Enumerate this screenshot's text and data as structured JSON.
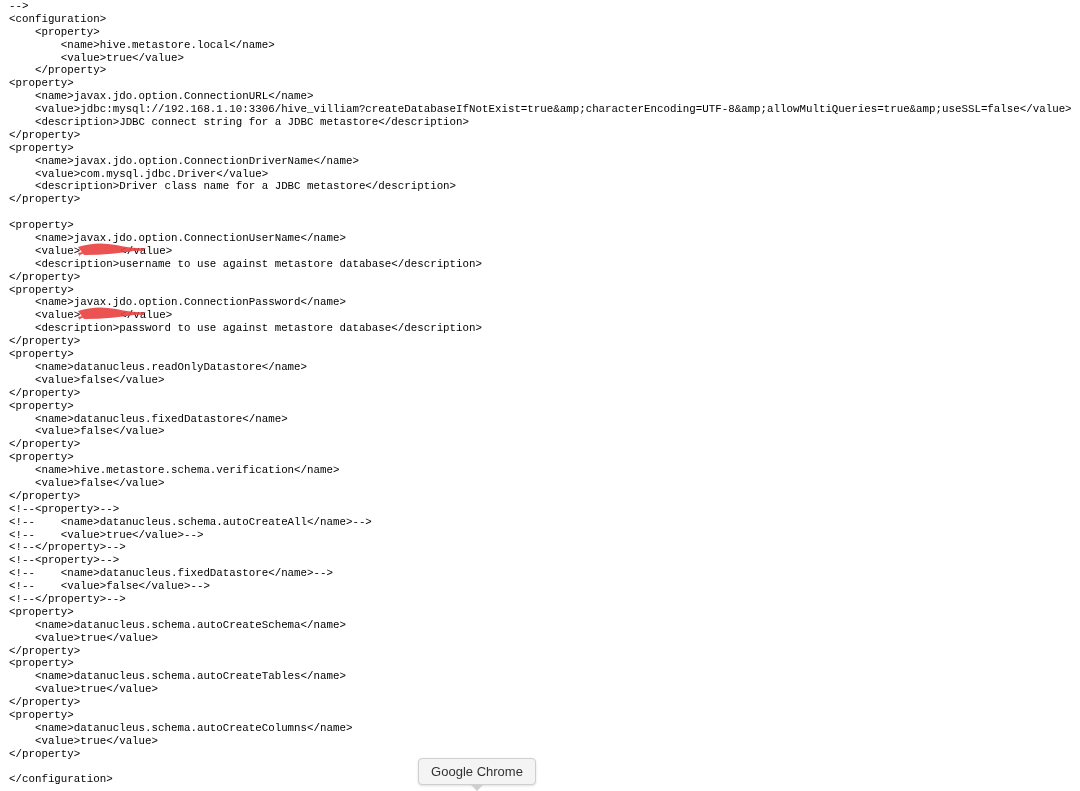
{
  "lines": [
    {
      "kind": "code",
      "text": "-->"
    },
    {
      "kind": "code",
      "text": "<configuration>"
    },
    {
      "kind": "code",
      "text": "    <property>"
    },
    {
      "kind": "code",
      "text": "        <name>hive.metastore.local</name>"
    },
    {
      "kind": "code",
      "text": "        <value>true</value>"
    },
    {
      "kind": "code",
      "text": "    </property>"
    },
    {
      "kind": "code",
      "text": "<property>"
    },
    {
      "kind": "code",
      "text": "    <name>javax.jdo.option.ConnectionURL</name>"
    },
    {
      "kind": "code",
      "text": "    <value>jdbc:mysql://192.168.1.10:3306/hive_villiam?createDatabaseIfNotExist=true&amp;characterEncoding=UTF-8&amp;allowMultiQueries=true&amp;useSSL=false</value>"
    },
    {
      "kind": "code",
      "text": "    <description>JDBC connect string for a JDBC metastore</description>"
    },
    {
      "kind": "code",
      "text": "</property>"
    },
    {
      "kind": "code",
      "text": "<property>"
    },
    {
      "kind": "code",
      "text": "    <name>javax.jdo.option.ConnectionDriverName</name>"
    },
    {
      "kind": "code",
      "text": "    <value>com.mysql.jdbc.Driver</value>"
    },
    {
      "kind": "code",
      "text": "    <description>Driver class name for a JDBC metastore</description>"
    },
    {
      "kind": "code",
      "text": "</property>"
    },
    {
      "kind": "blank"
    },
    {
      "kind": "code",
      "text": "<property>"
    },
    {
      "kind": "code",
      "text": "    <name>javax.jdo.option.ConnectionUserName</name>"
    },
    {
      "kind": "redacted",
      "prefix": "    <value>",
      "suffix": "</value>"
    },
    {
      "kind": "code",
      "text": "    <description>username to use against metastore database</description>"
    },
    {
      "kind": "code",
      "text": "</property>"
    },
    {
      "kind": "code",
      "text": "<property>"
    },
    {
      "kind": "code",
      "text": "    <name>javax.jdo.option.ConnectionPassword</name>"
    },
    {
      "kind": "redacted",
      "prefix": "    <value>",
      "suffix": "</value>"
    },
    {
      "kind": "code",
      "text": "    <description>password to use against metastore database</description>"
    },
    {
      "kind": "code",
      "text": "</property>"
    },
    {
      "kind": "code",
      "text": "<property>"
    },
    {
      "kind": "code",
      "text": "    <name>datanucleus.readOnlyDatastore</name>"
    },
    {
      "kind": "code",
      "text": "    <value>false</value>"
    },
    {
      "kind": "code",
      "text": "</property>"
    },
    {
      "kind": "code",
      "text": "<property>"
    },
    {
      "kind": "code",
      "text": "    <name>datanucleus.fixedDatastore</name>"
    },
    {
      "kind": "code",
      "text": "    <value>false</value>"
    },
    {
      "kind": "code",
      "text": "</property>"
    },
    {
      "kind": "code",
      "text": "<property>"
    },
    {
      "kind": "code",
      "text": "    <name>hive.metastore.schema.verification</name>"
    },
    {
      "kind": "code",
      "text": "    <value>false</value>"
    },
    {
      "kind": "code",
      "text": "</property>"
    },
    {
      "kind": "code",
      "text": "<!--<property>-->"
    },
    {
      "kind": "code",
      "text": "<!--    <name>datanucleus.schema.autoCreateAll</name>-->"
    },
    {
      "kind": "code",
      "text": "<!--    <value>true</value>-->"
    },
    {
      "kind": "code",
      "text": "<!--</property>-->"
    },
    {
      "kind": "code",
      "text": "<!--<property>-->"
    },
    {
      "kind": "code",
      "text": "<!--    <name>datanucleus.fixedDatastore</name>-->"
    },
    {
      "kind": "code",
      "text": "<!--    <value>false</value>-->"
    },
    {
      "kind": "code",
      "text": "<!--</property>-->"
    },
    {
      "kind": "code",
      "text": "<property>"
    },
    {
      "kind": "code",
      "text": "    <name>datanucleus.schema.autoCreateSchema</name>"
    },
    {
      "kind": "code",
      "text": "    <value>true</value>"
    },
    {
      "kind": "code",
      "text": "</property>"
    },
    {
      "kind": "code",
      "text": "<property>"
    },
    {
      "kind": "code",
      "text": "    <name>datanucleus.schema.autoCreateTables</name>"
    },
    {
      "kind": "code",
      "text": "    <value>true</value>"
    },
    {
      "kind": "code",
      "text": "</property>"
    },
    {
      "kind": "code",
      "text": "<property>"
    },
    {
      "kind": "code",
      "text": "    <name>datanucleus.schema.autoCreateColumns</name>"
    },
    {
      "kind": "code",
      "text": "    <value>true</value>"
    },
    {
      "kind": "code",
      "text": "</property>"
    },
    {
      "kind": "blank"
    },
    {
      "kind": "code",
      "text": "</configuration>"
    }
  ],
  "tooltip": {
    "text": "Google Chrome"
  }
}
